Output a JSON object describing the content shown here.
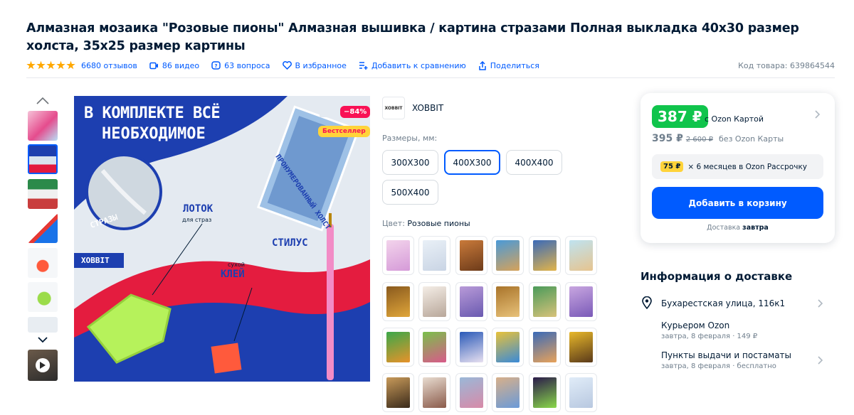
{
  "product": {
    "title": "Алмазная мозаика \"Розовые пионы\" Алмазная вышивка / картина стразами Полная выкладка 40x30 размер холста, 35x25 размер картины"
  },
  "meta": {
    "reviews": "6680 отзывов",
    "videos": "86 видео",
    "questions": "63 вопроса",
    "favorite": "В избранное",
    "compare": "Добавить к сравнению",
    "share": "Поделиться",
    "code": "Код товара: 639864544"
  },
  "image": {
    "headline_1": "В КОМПЛЕКТЕ ВСЁ",
    "headline_2": "НЕОБХОДИМОЕ",
    "discount": "−84%",
    "bestseller": "Бестселлер",
    "label_tray": "ЛОТОК",
    "label_tray_sub": "для страз",
    "label_stylus": "СТИЛУС",
    "label_glue_sub": "сухой",
    "label_glue": "КЛЕЙ",
    "label_stones": "СТРАЗЫ",
    "label_canvas": "ПРОНУМЕРОВАННЫЙ ХОЛСТ",
    "brand": "XOBBIT"
  },
  "seller": {
    "logo_text": "XOBBIT",
    "name": "XOBBIT"
  },
  "sizes": {
    "label": "Размеры, мм:",
    "options": [
      "300X300",
      "400X300",
      "400X400",
      "500X400"
    ],
    "selected": "400X300"
  },
  "color": {
    "label": "Цвет:",
    "value": "Розовые пионы"
  },
  "price": {
    "ozon_price": "387 ₽",
    "ozon_card_label": "с Ozon Картой",
    "regular": "395 ₽",
    "old": "2 600 ₽",
    "no_card_label": "без Ozon Карты",
    "installment_badge": "75 ₽",
    "installment_text": "× 6 месяцев в Ozon Рассрочку",
    "cart_button": "Добавить в корзину",
    "delivery_prefix": "Доставка",
    "delivery_day": "завтра"
  },
  "delivery": {
    "title": "Информация о доставке",
    "address": "Бухарестская улица, 116к1",
    "courier": "Курьером Ozon",
    "courier_when": "завтра, 8 февраля · 149 ₽",
    "pickup": "Пункты выдачи и постаматы",
    "pickup_when": "завтра, 8 февраля · бесплатно"
  },
  "colors": {
    "accent": "#005bff",
    "ozon_price": "#10c44c",
    "star": "#ffa800",
    "badge_yellow": "#ffd33a"
  },
  "icons": {
    "video": "video-camera-icon",
    "questions": "question-bubble-icon",
    "favorite": "heart-icon",
    "compare": "compare-icon",
    "share": "share-icon",
    "location": "map-pin-icon"
  }
}
